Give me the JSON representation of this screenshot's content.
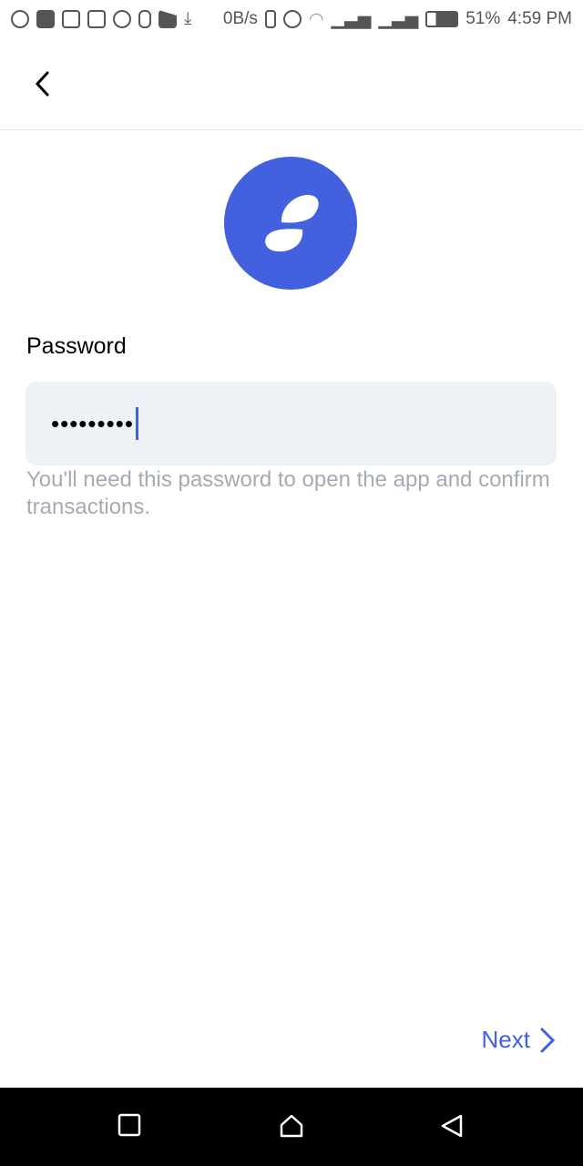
{
  "status_bar": {
    "net_speed": "0B/s",
    "battery": "51%",
    "time": "4:59 PM",
    "icons": [
      "whatsapp-icon",
      "youtube-icon",
      "gmail-icon",
      "gallery-icon",
      "s-icon",
      "lock-icon",
      "task-icon",
      "download-icon"
    ]
  },
  "form": {
    "label": "Password",
    "value": "•••••••••",
    "hint": "You'll need this password to open the app and confirm transactions."
  },
  "footer": {
    "next_label": "Next"
  },
  "colors": {
    "accent": "#4360DF",
    "input_bg": "#EEF1F5",
    "hint": "#A3ABB5"
  }
}
